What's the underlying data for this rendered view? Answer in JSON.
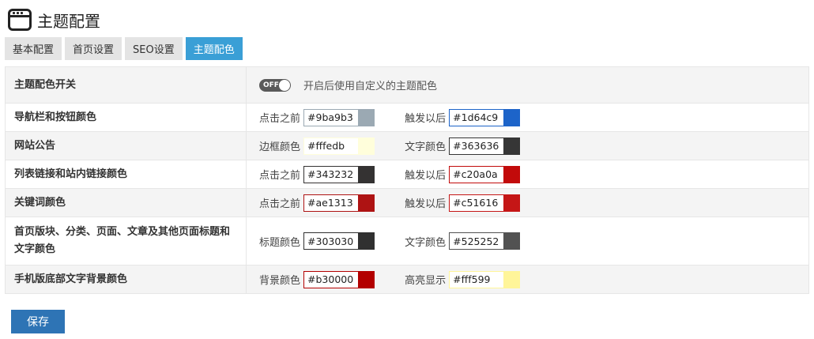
{
  "header": {
    "title": "主题配置"
  },
  "tabs": [
    {
      "label": "基本配置",
      "active": false
    },
    {
      "label": "首页设置",
      "active": false
    },
    {
      "label": "SEO设置",
      "active": false
    },
    {
      "label": "主题配色",
      "active": true
    }
  ],
  "colors": {
    "accent": "#3a9fd6",
    "save_button": "#2e74b5"
  },
  "settings": {
    "switch_row": {
      "label": "主题配色开关",
      "toggle_text": "OFF",
      "toggle_state": "off",
      "description": "开启后使用自定义的主题配色"
    },
    "rows": [
      {
        "label": "导航栏和按钮颜色",
        "left": {
          "label": "点击之前",
          "value": "#9ba9b3"
        },
        "right": {
          "label": "触发以后",
          "value": "#1d64c9"
        }
      },
      {
        "label": "网站公告",
        "left": {
          "label": "边框颜色",
          "value": "#fffedb"
        },
        "right": {
          "label": "文字颜色",
          "value": "#363636"
        }
      },
      {
        "label": "列表链接和站内链接颜色",
        "left": {
          "label": "点击之前",
          "value": "#343232"
        },
        "right": {
          "label": "触发以后",
          "value": "#c20a0a"
        }
      },
      {
        "label": "关键词颜色",
        "left": {
          "label": "点击之前",
          "value": "#ae1313"
        },
        "right": {
          "label": "触发以后",
          "value": "#c51616"
        }
      },
      {
        "label": "首页版块、分类、页面、文章及其他页面标题和文字颜色",
        "left": {
          "label": "标题颜色",
          "value": "#303030"
        },
        "right": {
          "label": "文字颜色",
          "value": "#525252"
        }
      },
      {
        "label": "手机版底部文字背景颜色",
        "left": {
          "label": "背景颜色",
          "value": "#b30000"
        },
        "right": {
          "label": "高亮显示",
          "value": "#fff599"
        }
      }
    ]
  },
  "save_label": "保存"
}
